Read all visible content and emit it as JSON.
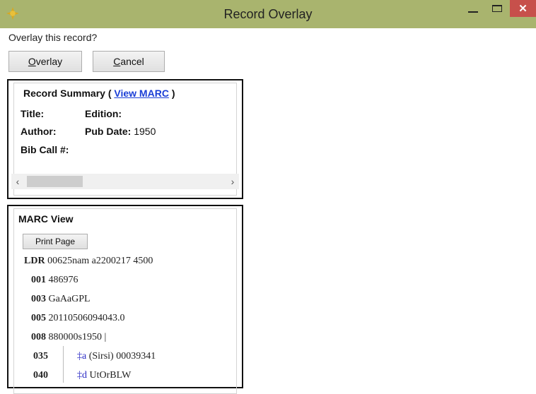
{
  "window": {
    "title": "Record Overlay",
    "icon": "leaf-app-icon",
    "controls": {
      "minimize": "minimize-icon",
      "maximize": "maximize-icon",
      "close": "✕"
    }
  },
  "prompt": "Overlay this record?",
  "buttons": {
    "overlay": {
      "mnemonic": "O",
      "rest": "verlay"
    },
    "cancel": {
      "mnemonic": "C",
      "rest": "ancel"
    }
  },
  "summary": {
    "heading": "Record Summary",
    "open_paren": "(",
    "close_paren": ")",
    "view_marc_link": "View MARC",
    "fields": {
      "title_label": "Title:",
      "title_value": "",
      "edition_label": "Edition:",
      "edition_value": "",
      "author_label": "Author:",
      "author_value": "",
      "pub_date_label": "Pub Date:",
      "pub_date_value": "1950",
      "bib_call_label": "Bib Call #:",
      "bib_call_value": ""
    },
    "scrollbar": {
      "left_arrow": "‹",
      "right_arrow": "›"
    }
  },
  "marc": {
    "heading": "MARC View",
    "print_button": "Print Page",
    "leader": {
      "tag": "LDR",
      "value": "00625nam a2200217 4500"
    },
    "control_fields": [
      {
        "tag": "001",
        "value": "486976"
      },
      {
        "tag": "003",
        "value": "GaAaGPL"
      },
      {
        "tag": "005",
        "value": "20110506094043.0"
      },
      {
        "tag": "008",
        "value": "880000s1950 |"
      }
    ],
    "data_fields": [
      {
        "tag": "035",
        "subfield": "‡a",
        "value": "(Sirsi) 00039341"
      },
      {
        "tag": "040",
        "subfield": "‡d",
        "value": "UtOrBLW"
      }
    ]
  },
  "colors": {
    "titlebar": "#a9b46e",
    "close_button": "#c7504b",
    "link": "#1a3ed6",
    "subfield": "#2a2ac4"
  }
}
